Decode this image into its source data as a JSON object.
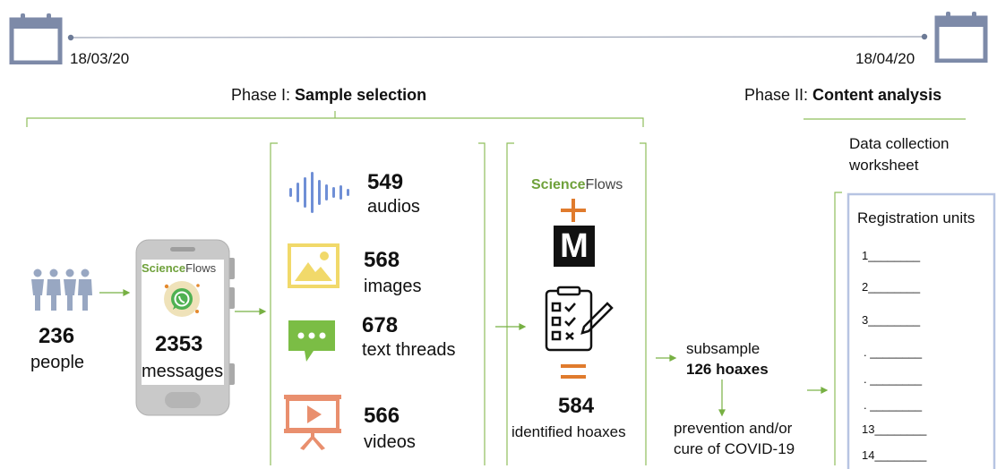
{
  "timeline": {
    "start_date": "18/03/20",
    "end_date": "18/04/20",
    "start_icon": "calendar-icon",
    "end_icon": "calendar-icon"
  },
  "phase1": {
    "prefix": "Phase I: ",
    "title": "Sample selection"
  },
  "phase2": {
    "prefix": "Phase II: ",
    "title": "Content analysis"
  },
  "people": {
    "count": "236",
    "label": "people",
    "icon": "people-icon"
  },
  "phone": {
    "brand_a": "Science",
    "brand_b": "Flows",
    "count": "2353",
    "label": "messages",
    "icons": [
      "smartphone-icon",
      "whatsapp-icon"
    ]
  },
  "media": [
    {
      "count": "549",
      "label": "audios",
      "icon": "audio-wave-icon"
    },
    {
      "count": "568",
      "label": "images",
      "icon": "image-icon"
    },
    {
      "count": "678",
      "label": "text threads",
      "icon": "chat-bubble-icon"
    },
    {
      "count": "566",
      "label": "videos",
      "icon": "video-presentation-icon"
    }
  ],
  "verification": {
    "brand_a": "Science",
    "brand_b": "Flows",
    "plus": "+",
    "m_logo": "M",
    "equals": "=",
    "count": "584",
    "label": "identified hoaxes",
    "icons": [
      "plus-icon",
      "maldita-logo-icon",
      "checklist-clipboard-icon",
      "equals-icon"
    ]
  },
  "subsample": {
    "label": "subsample",
    "value": "126 hoaxes",
    "focus": [
      "prevention and/or",
      "cure of COVID-19"
    ]
  },
  "worksheet": {
    "title_lines": [
      "Data collection",
      "worksheet"
    ],
    "heading": "Registration units",
    "rows": [
      "1________",
      "2________",
      "3________",
      ". ________",
      ". ________",
      ". ________",
      "13________",
      "14________"
    ]
  },
  "colors": {
    "timeline_icon": "#7d8aa8",
    "green": "#77b043",
    "audio": "#6f8fd6",
    "image": "#f1d96a",
    "chat": "#7bbd45",
    "video": "#e98f6e",
    "orange": "#e07b2d",
    "people": "#98a7c2"
  }
}
